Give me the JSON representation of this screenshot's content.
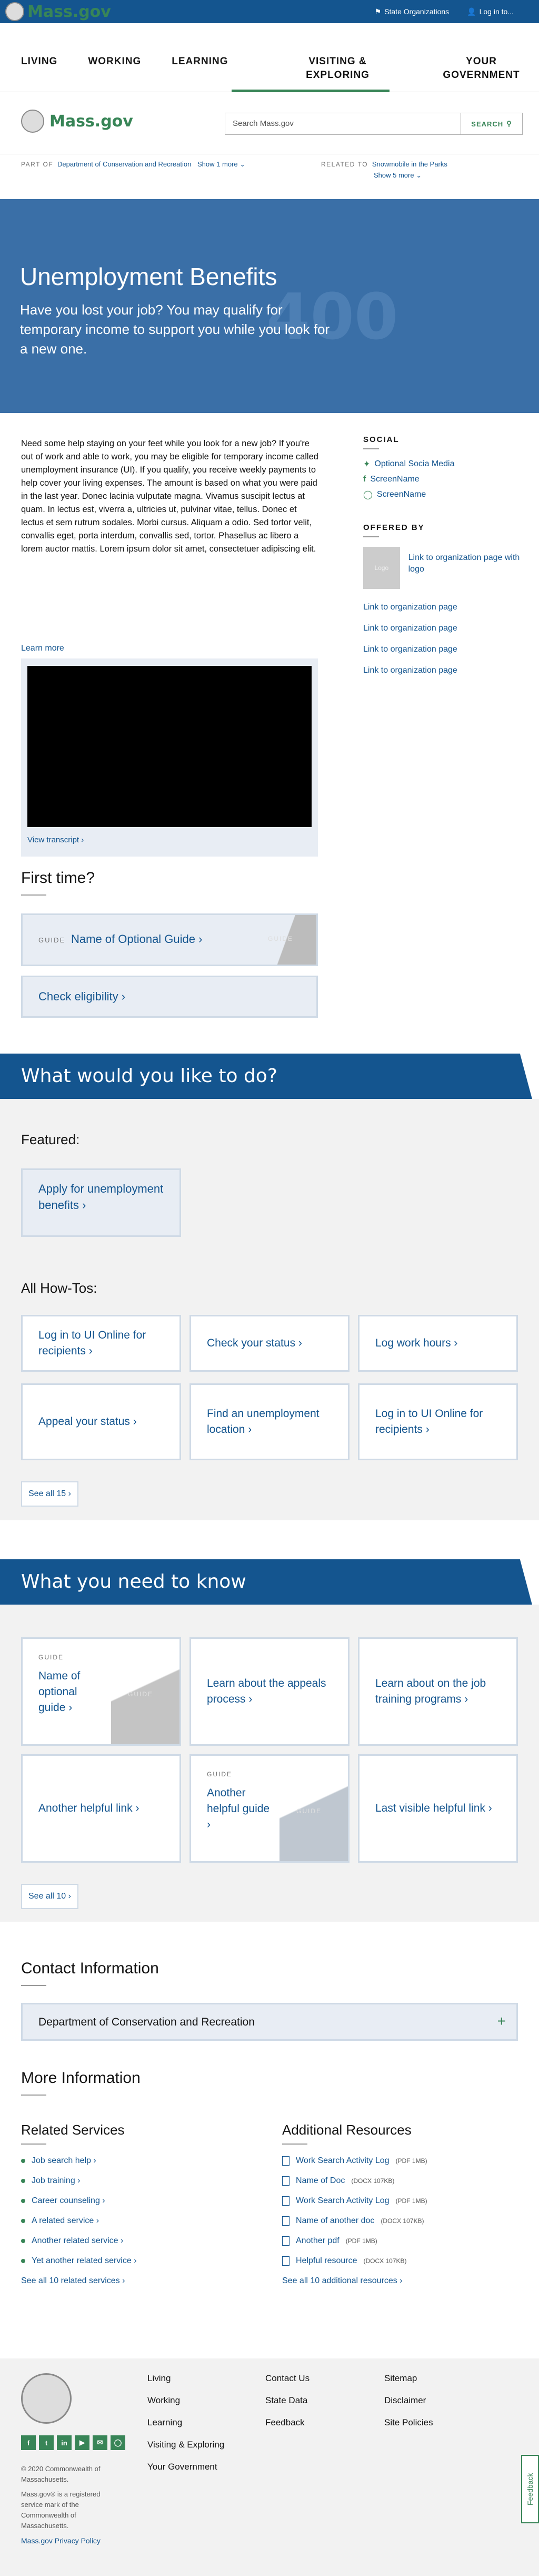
{
  "utility": {
    "state_orgs": "State Organizations",
    "login": "Log in to..."
  },
  "logo": {
    "text": "Mass.gov",
    "search_placeholder": "Search Mass.gov",
    "search_button": "SEARCH"
  },
  "nav": [
    "LIVING",
    "WORKING",
    "LEARNING",
    "VISITING & EXPLORING",
    "YOUR GOVERNMENT"
  ],
  "orgbar": {
    "part_of_label": "PART OF",
    "part_of_link": "Department of Conservation and Recreation",
    "show_more_1": "Show 1 more",
    "related_label": "RELATED TO",
    "related_link": "Snowmobile in the Parks",
    "show_more_5": "Show 5 more"
  },
  "hero": {
    "title": "Unemployment Benefits",
    "subtitle": "Have you lost your job? You may qualify for temporary income to support you while you look for a new one.",
    "ghost": "400"
  },
  "intro": "Need some help staying on your feet while you look for a new job? If you're out of work and able to work, you may be eligible for temporary income called unemployment insurance (UI). If you qualify, you receive weekly payments to help cover your living expenses. The amount is based on what you were paid in the last year. Donec lacinia vulputate magna. Vivamus suscipit lectus at quam. In lectus est, viverra a, ultricies ut, pulvinar vitae, tellus. Donec et lectus et sem rutrum sodales. Morbi cursus. Aliquam a odio. Sed tortor velit, convallis eget, porta interdum, convallis sed, tortor. Phasellus ac libero a lorem auctor mattis. Lorem ipsum dolor sit amet, consectetuer adipiscing elit.",
  "sidebar": {
    "social_heading": "SOCIAL",
    "social_links": [
      "Optional Socia Media",
      "ScreenName",
      "ScreenName"
    ],
    "offered_heading": "OFFERED BY",
    "offered_logo_text": "Logo",
    "offered_first": "Link to organization page with logo",
    "offered_links": [
      "Link to organization page",
      "Link to organization page",
      "Link to organization page",
      "Link to organization page"
    ]
  },
  "video": {
    "learn_more": "Learn more",
    "transcript": "View transcript"
  },
  "first_time": {
    "heading": "First time?",
    "guide_tag": "GUIDE",
    "guide_name": "Name of Optional Guide",
    "guide_diag": "GUIDE",
    "check": "Check eligibility"
  },
  "todo": {
    "banner": "What would you like to do?",
    "featured_heading": "Featured:",
    "featured": "Apply for unemployment benefits",
    "howtos_heading": "All How-Tos:",
    "howtos": [
      "Log in to UI Online for recipients",
      "Check your status",
      "Log work hours",
      "Appeal your status",
      "Find an unemployment location",
      "Log in to UI Online for recipients"
    ],
    "see_all": "See all 15"
  },
  "know": {
    "banner": "What you need to know",
    "guide_tag": "GUIDE",
    "cards": [
      "Name of optional guide",
      "Learn about the appeals process",
      "Learn about on the job training programs",
      "Another helpful link",
      "Another helpful guide",
      "Last visible helpful link"
    ],
    "see_all": "See all 10"
  },
  "contact": {
    "heading": "Contact Information",
    "accordion": "Department of Conservation and Recreation"
  },
  "more": {
    "heading": "More Information",
    "related_heading": "Related Services",
    "related": [
      "Job search help",
      "Job training",
      "Career counseling",
      "A related service",
      "Another related service",
      "Yet another related service"
    ],
    "related_see_all": "See all 10 related services",
    "additional_heading": "Additional Resources",
    "resources": [
      {
        "name": "Work Search Activity Log",
        "type": "(PDF 1MB)"
      },
      {
        "name": "Name of Doc",
        "type": "(DOCX 107KB)"
      },
      {
        "name": "Work Search Activity Log",
        "type": "(PDF 1MB)"
      },
      {
        "name": "Name of another doc",
        "type": "(DOCX 107KB)"
      },
      {
        "name": "Another pdf",
        "type": "(PDF 1MB)"
      },
      {
        "name": "Helpful resource",
        "type": "(DOCX 107KB)"
      }
    ],
    "additional_see_all": "See all 10 additional resources"
  },
  "footer": {
    "col1": [
      "Living",
      "Working",
      "Learning",
      "Visiting & Exploring",
      "Your Government"
    ],
    "col2": [
      "Contact Us",
      "State Data",
      "Feedback"
    ],
    "col3": [
      "Sitemap",
      "Disclaimer",
      "Site Policies"
    ],
    "copyright": "© 2020 Commonwealth of Massachusetts.",
    "trademark": "Mass.gov® is a registered service mark of the Commonwealth of Massachusetts.",
    "privacy": "Mass.gov Privacy Policy",
    "feedback": "Feedback"
  },
  "colors": {
    "primary": "#14558f",
    "green": "#388557",
    "hero": "#3a6fa7",
    "light": "#e8edf4"
  }
}
